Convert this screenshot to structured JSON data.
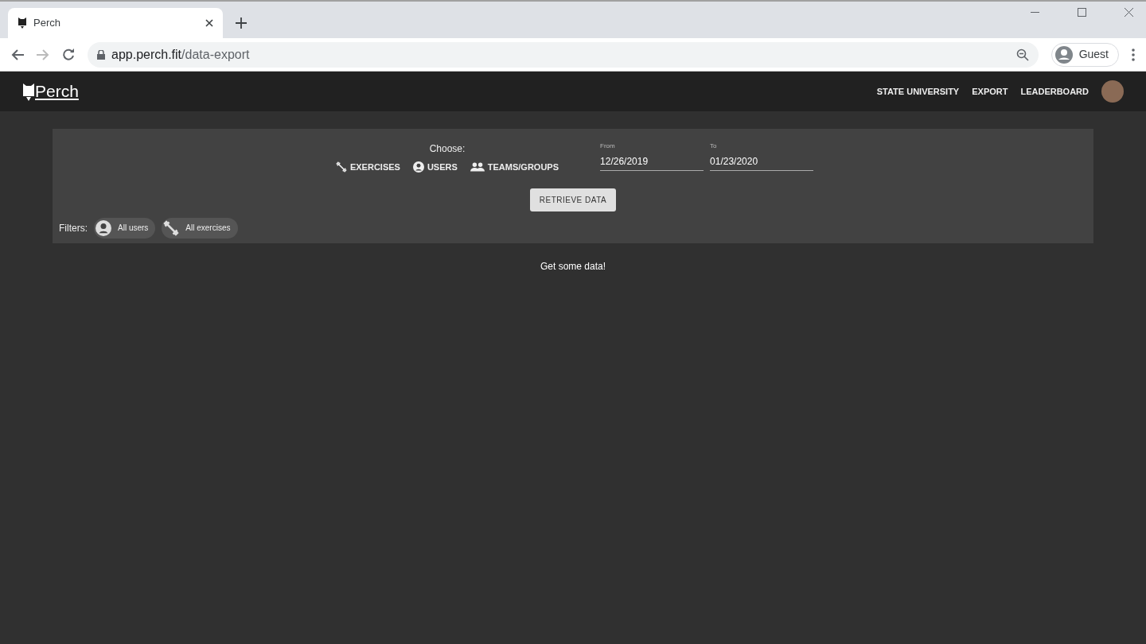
{
  "browser": {
    "tab_title": "Perch",
    "url_host": "app.perch.fit",
    "url_path": "/data-export",
    "profile": "Guest"
  },
  "navbar": {
    "brand": "Perch",
    "links": [
      "STATE UNIVERSITY",
      "EXPORT",
      "LEADERBOARD"
    ]
  },
  "export_panel": {
    "choose_label": "Choose:",
    "options": [
      {
        "kind": "exercises",
        "label": "EXERCISES"
      },
      {
        "kind": "users",
        "label": "USERS"
      },
      {
        "kind": "teams",
        "label": "TEAMS/GROUPS"
      }
    ],
    "from": {
      "label": "From",
      "value": "12/26/2019"
    },
    "to": {
      "label": "To",
      "value": "01/23/2020"
    },
    "retrieve_button": "RETRIEVE DATA",
    "filters_label": "Filters:",
    "filters": [
      {
        "kind": "users",
        "label": "All users"
      },
      {
        "kind": "exercises",
        "label": "All exercises"
      }
    ]
  },
  "message": "Get some data!"
}
